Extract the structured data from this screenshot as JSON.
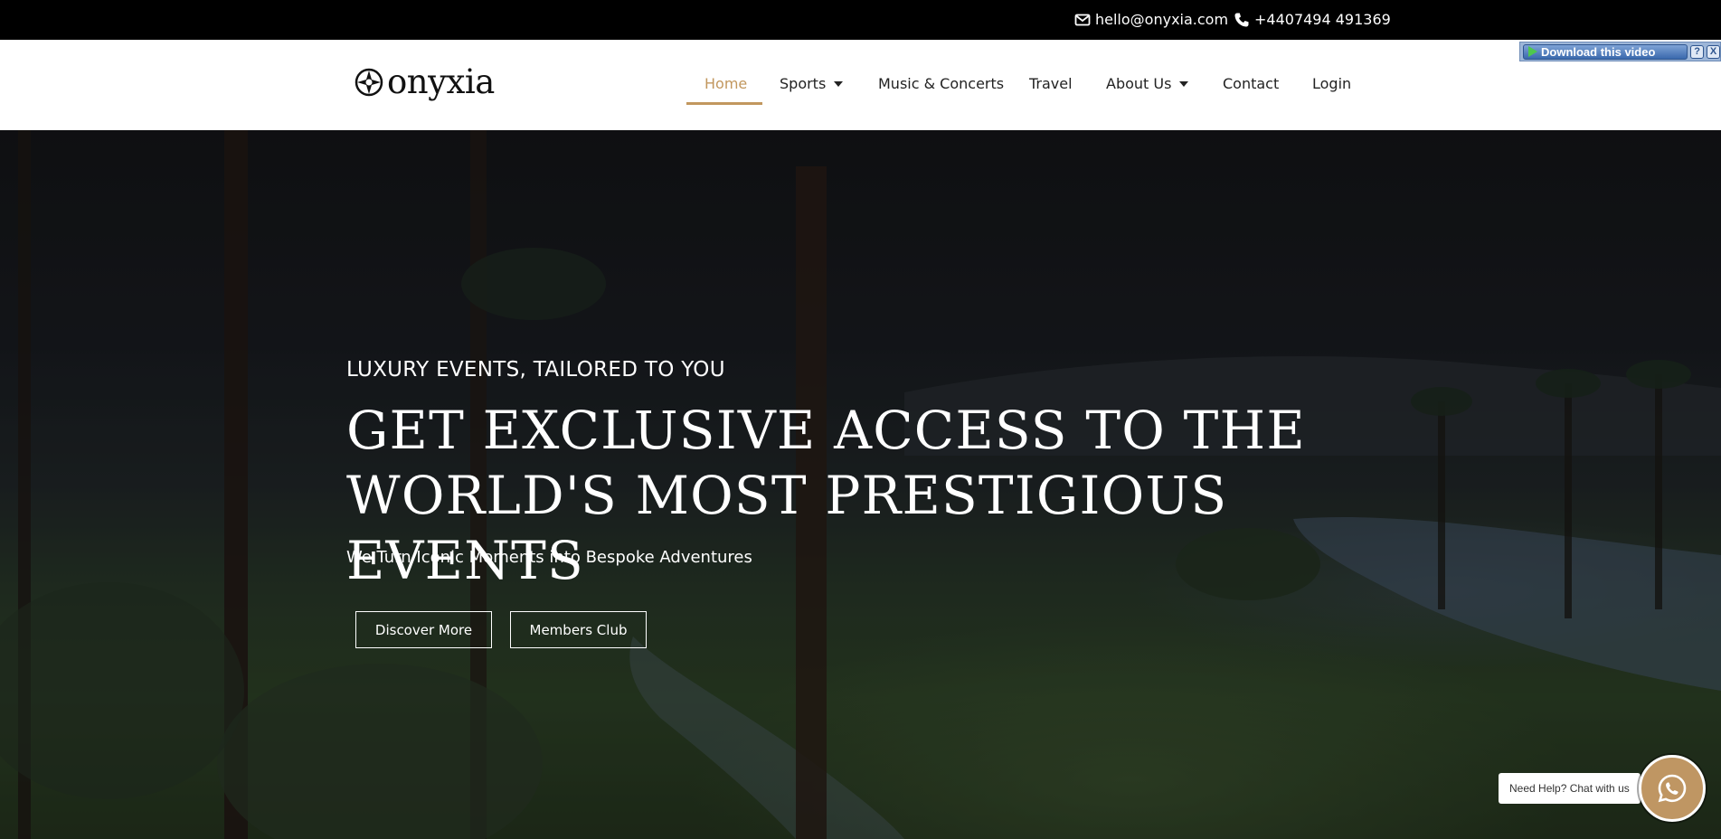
{
  "topbar": {
    "email": "hello@onyxia.com",
    "phone": "+4407494 491369",
    "email_icon": "envelope-icon",
    "phone_icon": "phone-icon"
  },
  "header": {
    "logo_text": "onyxia",
    "nav": [
      {
        "label": "Home",
        "active": true
      },
      {
        "label": "Sports",
        "has_dropdown": true
      },
      {
        "label": "Music & Concerts"
      },
      {
        "label": "Travel"
      },
      {
        "label": "About Us",
        "has_dropdown": true
      },
      {
        "label": "Contact"
      },
      {
        "label": "Login"
      }
    ]
  },
  "plugin": {
    "download_label": "Download this video",
    "help_label": "?",
    "close_label": "X"
  },
  "hero": {
    "eyebrow": "LUXURY EVENTS, TAILORED TO YOU",
    "headline_line1": "GET EXCLUSIVE ACCESS TO THE",
    "headline_line2": "WORLD'S MOST PRESTIGIOUS EVENTS",
    "subline": "We Turn Iconic Moments into Bespoke Adventures",
    "buttons": {
      "discover": "Discover More",
      "members": "Members Club"
    }
  },
  "chat": {
    "bubble": "Need Help? Chat with us",
    "icon": "whatsapp-icon"
  },
  "colors": {
    "accent": "#c2975e",
    "topbar_bg": "#000000",
    "header_bg": "#ffffff",
    "chat_bg": "#bf9663"
  }
}
